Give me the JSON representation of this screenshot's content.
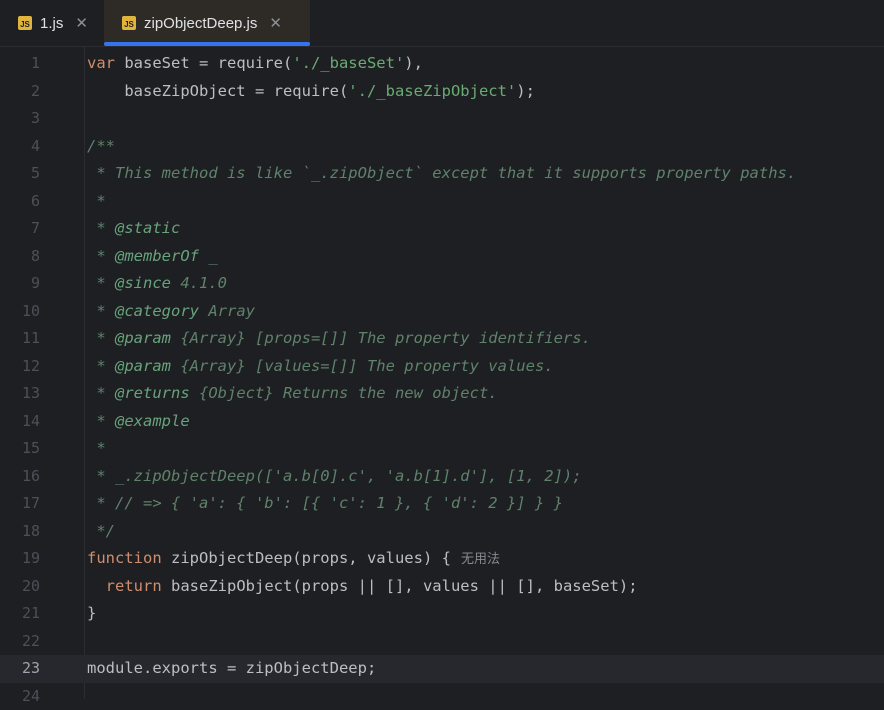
{
  "tabs": [
    {
      "icon": "js-file-icon",
      "icon_text": "JS",
      "label": "1.js",
      "active": false
    },
    {
      "icon": "js-file-icon",
      "icon_text": "JS",
      "label": "zipObjectDeep.js",
      "active": true
    }
  ],
  "colors": {
    "background": "#1e1f22",
    "keyword": "#cf8e6d",
    "string": "#6aab73",
    "doc_comment": "#5f826b",
    "doc_tag": "#67a37c",
    "text": "#bcbec4",
    "line_number": "#4b5059",
    "active_tab_underline": "#3574f0"
  },
  "editor": {
    "current_line": 23,
    "inlay_hint": "无用法",
    "lines": [
      {
        "n": "1",
        "tokens": [
          [
            "kw",
            "var"
          ],
          [
            "plain",
            " baseSet = require("
          ],
          [
            "str",
            "'./_baseSet'"
          ],
          [
            "plain",
            "),"
          ]
        ]
      },
      {
        "n": "2",
        "tokens": [
          [
            "plain",
            "    baseZipObject = require("
          ],
          [
            "str",
            "'./_baseZipObject'"
          ],
          [
            "plain",
            ");"
          ]
        ]
      },
      {
        "n": "3",
        "tokens": []
      },
      {
        "n": "4",
        "tokens": [
          [
            "doc",
            "/**"
          ]
        ]
      },
      {
        "n": "5",
        "tokens": [
          [
            "doc",
            " * This method is like `_.zipObject` except that it supports property paths."
          ]
        ]
      },
      {
        "n": "6",
        "tokens": [
          [
            "doc",
            " *"
          ]
        ]
      },
      {
        "n": "7",
        "tokens": [
          [
            "doc",
            " * "
          ],
          [
            "tag",
            "@static"
          ]
        ]
      },
      {
        "n": "8",
        "tokens": [
          [
            "doc",
            " * "
          ],
          [
            "tag",
            "@memberOf"
          ],
          [
            "doc",
            " _"
          ]
        ]
      },
      {
        "n": "9",
        "tokens": [
          [
            "doc",
            " * "
          ],
          [
            "tag",
            "@since"
          ],
          [
            "doc",
            " 4.1.0"
          ]
        ]
      },
      {
        "n": "10",
        "tokens": [
          [
            "doc",
            " * "
          ],
          [
            "tag",
            "@category"
          ],
          [
            "doc",
            " Array"
          ]
        ]
      },
      {
        "n": "11",
        "tokens": [
          [
            "doc",
            " * "
          ],
          [
            "tag",
            "@param"
          ],
          [
            "doc",
            " {Array} [props=[]] The property identifiers."
          ]
        ]
      },
      {
        "n": "12",
        "tokens": [
          [
            "doc",
            " * "
          ],
          [
            "tag",
            "@param"
          ],
          [
            "doc",
            " {Array} [values=[]] The property values."
          ]
        ]
      },
      {
        "n": "13",
        "tokens": [
          [
            "doc",
            " * "
          ],
          [
            "tag",
            "@returns"
          ],
          [
            "doc",
            " {Object} Returns the new object."
          ]
        ]
      },
      {
        "n": "14",
        "tokens": [
          [
            "doc",
            " * "
          ],
          [
            "tag",
            "@example"
          ]
        ]
      },
      {
        "n": "15",
        "tokens": [
          [
            "doc",
            " *"
          ]
        ]
      },
      {
        "n": "16",
        "tokens": [
          [
            "doc",
            " * _.zipObjectDeep(['a.b[0].c', 'a.b[1].d'], [1, 2]);"
          ]
        ]
      },
      {
        "n": "17",
        "tokens": [
          [
            "doc",
            " * // => { 'a': { 'b': [{ 'c': 1 }, { 'd': 2 }] } }"
          ]
        ]
      },
      {
        "n": "18",
        "tokens": [
          [
            "doc",
            " */"
          ]
        ]
      },
      {
        "n": "19",
        "tokens": [
          [
            "kw",
            "function"
          ],
          [
            "plain",
            " zipObjectDeep(props, values) {"
          ]
        ],
        "hint": true
      },
      {
        "n": "20",
        "tokens": [
          [
            "plain",
            "  "
          ],
          [
            "kw",
            "return"
          ],
          [
            "plain",
            " baseZipObject(props || [], values || [], baseSet);"
          ]
        ]
      },
      {
        "n": "21",
        "tokens": [
          [
            "plain",
            "}"
          ]
        ]
      },
      {
        "n": "22",
        "tokens": []
      },
      {
        "n": "23",
        "tokens": [
          [
            "plain",
            "module.exports = zipObjectDeep;"
          ]
        ]
      },
      {
        "n": "24",
        "tokens": []
      }
    ]
  }
}
